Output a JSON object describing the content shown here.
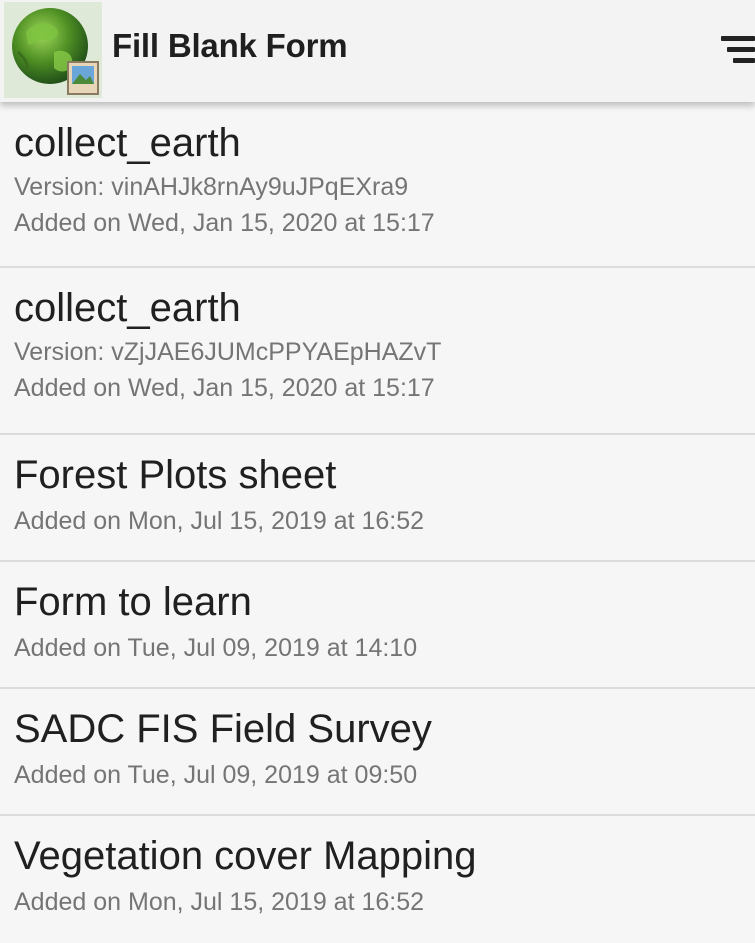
{
  "header": {
    "title": "Fill Blank Form",
    "app_icon": "earth-globe-icon",
    "sort_icon": "sort-icon"
  },
  "forms": [
    {
      "name": "collect_earth",
      "version": "Version: vinAHJk8rnAy9uJPqEXra9",
      "date": "Added on Wed, Jan 15, 2020 at 15:17"
    },
    {
      "name": "collect_earth",
      "version": "Version: vZjJAE6JUMcPPYAEpHAZvT",
      "date": "Added on Wed, Jan 15, 2020 at 15:17"
    },
    {
      "name": "Forest Plots sheet",
      "date": "Added on Mon, Jul 15, 2019 at 16:52"
    },
    {
      "name": "Form to learn",
      "date": "Added on Tue, Jul 09, 2019 at 14:10"
    },
    {
      "name": "SADC FIS Field Survey",
      "date": "Added on Tue, Jul 09, 2019 at 09:50"
    },
    {
      "name": "Vegetation cover Mapping",
      "date": "Added on Mon, Jul 15, 2019 at 16:52"
    }
  ],
  "colors": {
    "app_bar": "#f3f3f3",
    "list_bg": "#f6f6f6",
    "divider": "#dcdcdc",
    "title_text": "#202020",
    "secondary_text": "#757575",
    "globe_green": "#5a9a2c"
  }
}
